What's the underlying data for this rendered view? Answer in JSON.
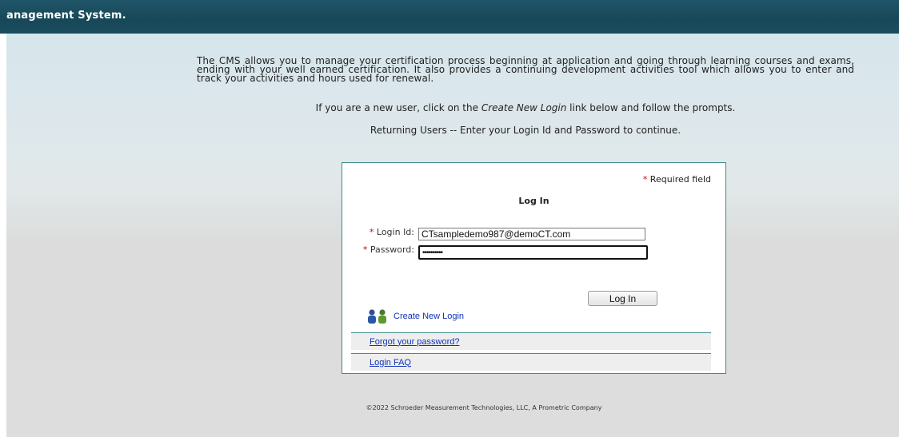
{
  "header": {
    "title": "anagement System."
  },
  "intro": {
    "paragraph": "The CMS allows you to manage your certification process beginning at application and going through learning courses and exams, ending with your well earned certification. It also provides a continuing development activities tool which allows you to enter and track your activities and hours used for renewal.",
    "new_user_prefix": "If you are a new user, click on the ",
    "new_user_link_text": "Create New Login",
    "new_user_suffix": " link below and follow the prompts.",
    "returning_users": "Returning Users -- Enter your Login Id and Password to continue."
  },
  "login_panel": {
    "required_star": "*",
    "required_text": " Required field",
    "heading": "Log In",
    "login_id_label": "Login Id:",
    "login_id_value": "CTsampledemo987@demoCT.com",
    "password_label": "Password:",
    "password_value": "••••••••••",
    "submit_label": "Log In",
    "create_login_label": "Create New Login",
    "forgot_password_label": "Forgot your password?",
    "faq_label": "Login FAQ"
  },
  "footer": {
    "copyright": "©2022 Schroeder Measurement Technologies, LLC, A Prometric Company"
  },
  "colors": {
    "header_bg": "#174858",
    "panel_border": "#3f8c8f",
    "required_star": "#d40000",
    "link": "#1033b8"
  },
  "icons": {
    "create_login": "users-icon"
  }
}
